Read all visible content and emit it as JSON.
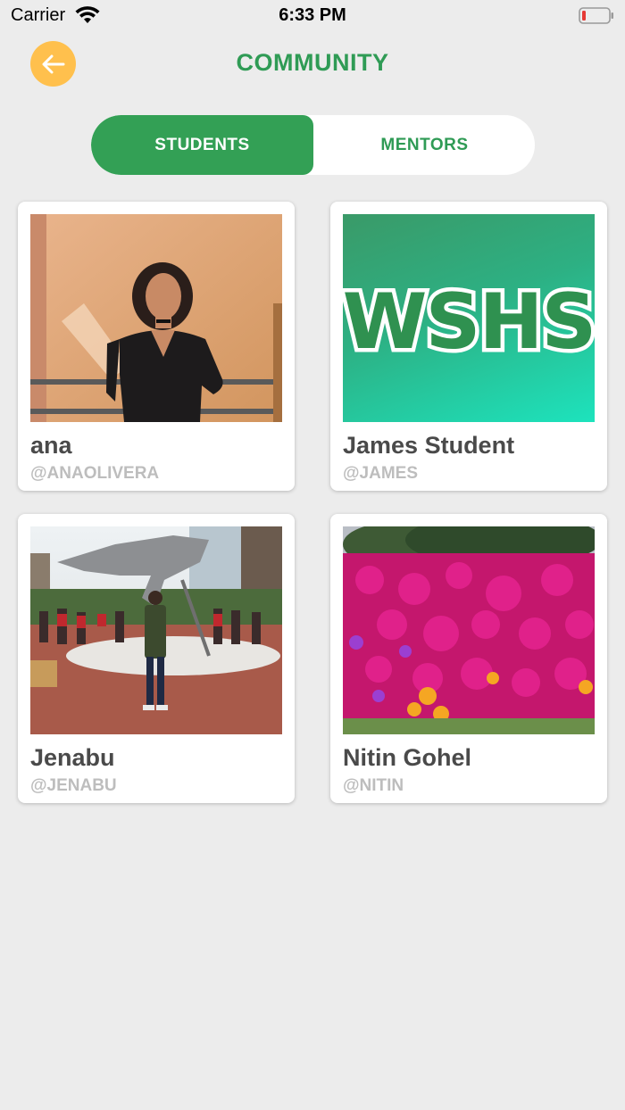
{
  "status_bar": {
    "carrier": "Carrier",
    "time": "6:33 PM"
  },
  "header": {
    "title": "COMMUNITY",
    "back_icon": "arrow-left-icon"
  },
  "tabs": [
    {
      "label": "STUDENTS",
      "active": true
    },
    {
      "label": "MENTORS",
      "active": false
    }
  ],
  "members": [
    {
      "name": "ana",
      "handle": "@ANAOLIVERA",
      "photo": "portrait of woman in black sweater"
    },
    {
      "name": "James Student",
      "handle": "@JAMES",
      "photo": "WSHS logo"
    },
    {
      "name": "Jenabu",
      "handle": "@JENABU",
      "photo": "man standing by hockey statue"
    },
    {
      "name": "Nitin Gohel",
      "handle": "@NITIN",
      "photo": "pink flowers"
    }
  ],
  "logo_text": "WSHS",
  "colors": {
    "accent_green": "#33a055",
    "back_button": "#ffc04d",
    "background": "#ececec"
  }
}
